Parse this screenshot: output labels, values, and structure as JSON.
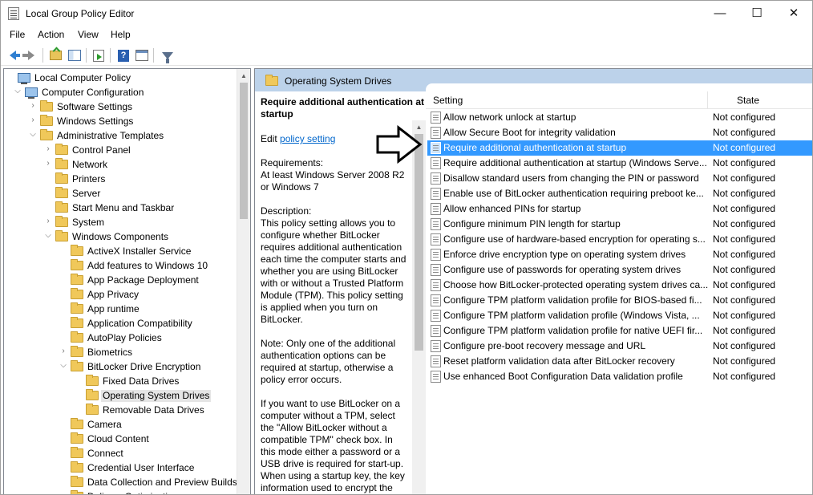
{
  "window": {
    "title": "Local Group Policy Editor"
  },
  "window_controls": {
    "minimize": "—",
    "maximize": "☐",
    "close": "✕"
  },
  "menu": [
    "File",
    "Action",
    "View",
    "Help"
  ],
  "tree": {
    "items": [
      {
        "label": "Local Computer Policy",
        "type": "pc",
        "level": 0,
        "expander": ""
      },
      {
        "label": "Computer Configuration",
        "type": "pc",
        "level": 1,
        "expander": "open"
      },
      {
        "label": "Software Settings",
        "type": "folder",
        "level": 2,
        "expander": "closed"
      },
      {
        "label": "Windows Settings",
        "type": "folder",
        "level": 2,
        "expander": "closed"
      },
      {
        "label": "Administrative Templates",
        "type": "folder",
        "level": 2,
        "expander": "open"
      },
      {
        "label": "Control Panel",
        "type": "folder",
        "level": 3,
        "expander": "closed"
      },
      {
        "label": "Network",
        "type": "folder",
        "level": 3,
        "expander": "closed"
      },
      {
        "label": "Printers",
        "type": "folder",
        "level": 3,
        "expander": ""
      },
      {
        "label": "Server",
        "type": "folder",
        "level": 3,
        "expander": ""
      },
      {
        "label": "Start Menu and Taskbar",
        "type": "folder",
        "level": 3,
        "expander": ""
      },
      {
        "label": "System",
        "type": "folder",
        "level": 3,
        "expander": "closed"
      },
      {
        "label": "Windows Components",
        "type": "folder",
        "level": 3,
        "expander": "open"
      },
      {
        "label": "ActiveX Installer Service",
        "type": "folder",
        "level": 4,
        "expander": ""
      },
      {
        "label": "Add features to Windows 10",
        "type": "folder",
        "level": 4,
        "expander": ""
      },
      {
        "label": "App Package Deployment",
        "type": "folder",
        "level": 4,
        "expander": ""
      },
      {
        "label": "App Privacy",
        "type": "folder",
        "level": 4,
        "expander": ""
      },
      {
        "label": "App runtime",
        "type": "folder",
        "level": 4,
        "expander": ""
      },
      {
        "label": "Application Compatibility",
        "type": "folder",
        "level": 4,
        "expander": ""
      },
      {
        "label": "AutoPlay Policies",
        "type": "folder",
        "level": 4,
        "expander": ""
      },
      {
        "label": "Biometrics",
        "type": "folder",
        "level": 4,
        "expander": "closed"
      },
      {
        "label": "BitLocker Drive Encryption",
        "type": "folder",
        "level": 4,
        "expander": "open"
      },
      {
        "label": "Fixed Data Drives",
        "type": "folder",
        "level": 5,
        "expander": ""
      },
      {
        "label": "Operating System Drives",
        "type": "folder",
        "level": 5,
        "expander": "",
        "selected": true
      },
      {
        "label": "Removable Data Drives",
        "type": "folder",
        "level": 5,
        "expander": ""
      },
      {
        "label": "Camera",
        "type": "folder",
        "level": 4,
        "expander": ""
      },
      {
        "label": "Cloud Content",
        "type": "folder",
        "level": 4,
        "expander": ""
      },
      {
        "label": "Connect",
        "type": "folder",
        "level": 4,
        "expander": ""
      },
      {
        "label": "Credential User Interface",
        "type": "folder",
        "level": 4,
        "expander": ""
      },
      {
        "label": "Data Collection and Preview Builds",
        "type": "folder",
        "level": 4,
        "expander": ""
      },
      {
        "label": "Delivery Optimization",
        "type": "folder",
        "level": 4,
        "expander": ""
      }
    ]
  },
  "header": {
    "title": "Operating System Drives"
  },
  "description": {
    "title": "Require additional authentication at startup",
    "edit_prefix": "Edit ",
    "edit_link": "policy setting ",
    "paragraphs": [
      "Requirements:\nAt least Windows Server 2008 R2 or Windows 7",
      "Description:\nThis policy setting allows you to configure whether BitLocker requires additional authentication each time the computer starts and whether you are using BitLocker with or without a Trusted Platform Module (TPM). This policy setting is applied when you turn on BitLocker.",
      "Note: Only one of the additional authentication options can be required at startup, otherwise a policy error occurs.",
      "If you want to use BitLocker on a computer without a TPM, select the \"Allow BitLocker without a compatible TPM\" check box. In this mode either a password or a USB drive is required for start-up. When using a startup key, the key information used to encrypt the"
    ]
  },
  "list": {
    "columns": {
      "setting": "Setting",
      "state": "State"
    },
    "rows": [
      {
        "name": "Allow network unlock at startup",
        "state": "Not configured"
      },
      {
        "name": "Allow Secure Boot for integrity validation",
        "state": "Not configured"
      },
      {
        "name": "Require additional authentication at startup",
        "state": "Not configured",
        "selected": true
      },
      {
        "name": "Require additional authentication at startup (Windows Serve...",
        "state": "Not configured"
      },
      {
        "name": "Disallow standard users from changing the PIN or password",
        "state": "Not configured"
      },
      {
        "name": "Enable use of BitLocker authentication requiring preboot ke...",
        "state": "Not configured"
      },
      {
        "name": "Allow enhanced PINs for startup",
        "state": "Not configured"
      },
      {
        "name": "Configure minimum PIN length for startup",
        "state": "Not configured"
      },
      {
        "name": "Configure use of hardware-based encryption for operating s...",
        "state": "Not configured"
      },
      {
        "name": "Enforce drive encryption type on operating system drives",
        "state": "Not configured"
      },
      {
        "name": "Configure use of passwords for operating system drives",
        "state": "Not configured"
      },
      {
        "name": "Choose how BitLocker-protected operating system drives ca...",
        "state": "Not configured"
      },
      {
        "name": "Configure TPM platform validation profile for BIOS-based fi...",
        "state": "Not configured"
      },
      {
        "name": "Configure TPM platform validation profile (Windows Vista, ...",
        "state": "Not configured"
      },
      {
        "name": "Configure TPM platform validation profile for native UEFI fir...",
        "state": "Not configured"
      },
      {
        "name": "Configure pre-boot recovery message and URL",
        "state": "Not configured"
      },
      {
        "name": "Reset platform validation data after BitLocker recovery",
        "state": "Not configured"
      },
      {
        "name": "Use enhanced Boot Configuration Data validation profile",
        "state": "Not configured"
      }
    ]
  },
  "colors": {
    "selection": "#3399ff",
    "header_band": "#bcd2ea",
    "link": "#0066cc"
  }
}
